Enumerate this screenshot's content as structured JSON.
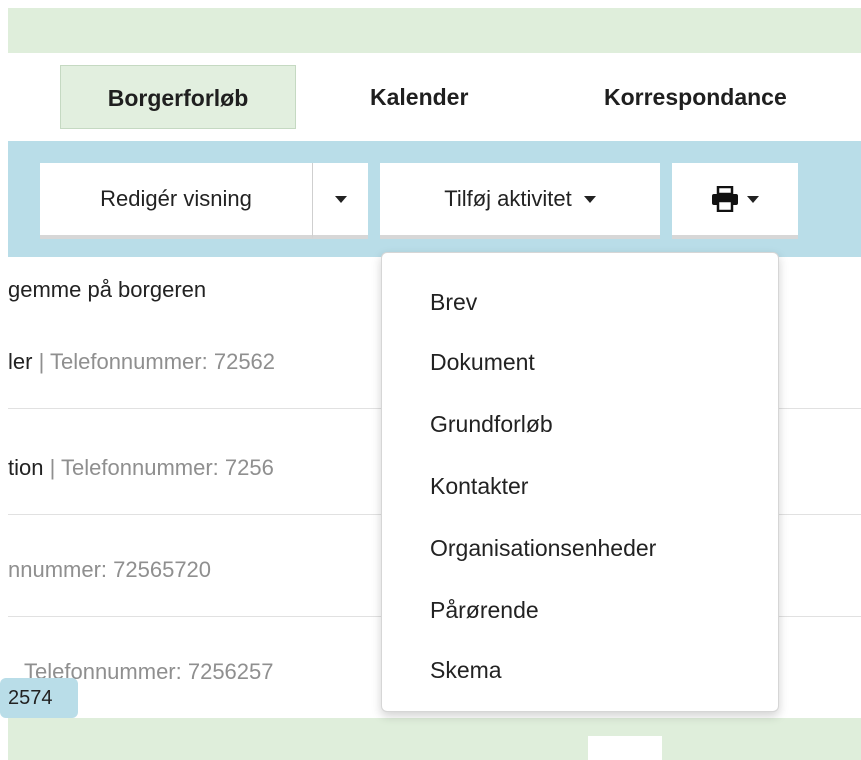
{
  "tabs": {
    "borgerforloeb": "Borgerforløb",
    "kalender": "Kalender",
    "korrespondance": "Korrespondance"
  },
  "toolbar": {
    "rediger_label": "Redigér visning",
    "tilfoej_label": "Tilføj aktivitet"
  },
  "rows": [
    {
      "strong": "gemme på borgeren",
      "muted": ""
    },
    {
      "strong": "ler",
      "muted": " | Telefonnummer: 72562"
    },
    {
      "strong": "tion",
      "muted": " | Telefonnummer: 7256"
    },
    {
      "strong": "",
      "muted": "nnummer: 72565720"
    },
    {
      "strong": "",
      "muted": "Telefonnummer: 7256257"
    }
  ],
  "badge": "2574",
  "menu": {
    "items": [
      "Brev",
      "Dokument",
      "Grundforløb",
      "Kontakter",
      "Organisationsenheder",
      "Pårørende",
      "Skema"
    ]
  }
}
